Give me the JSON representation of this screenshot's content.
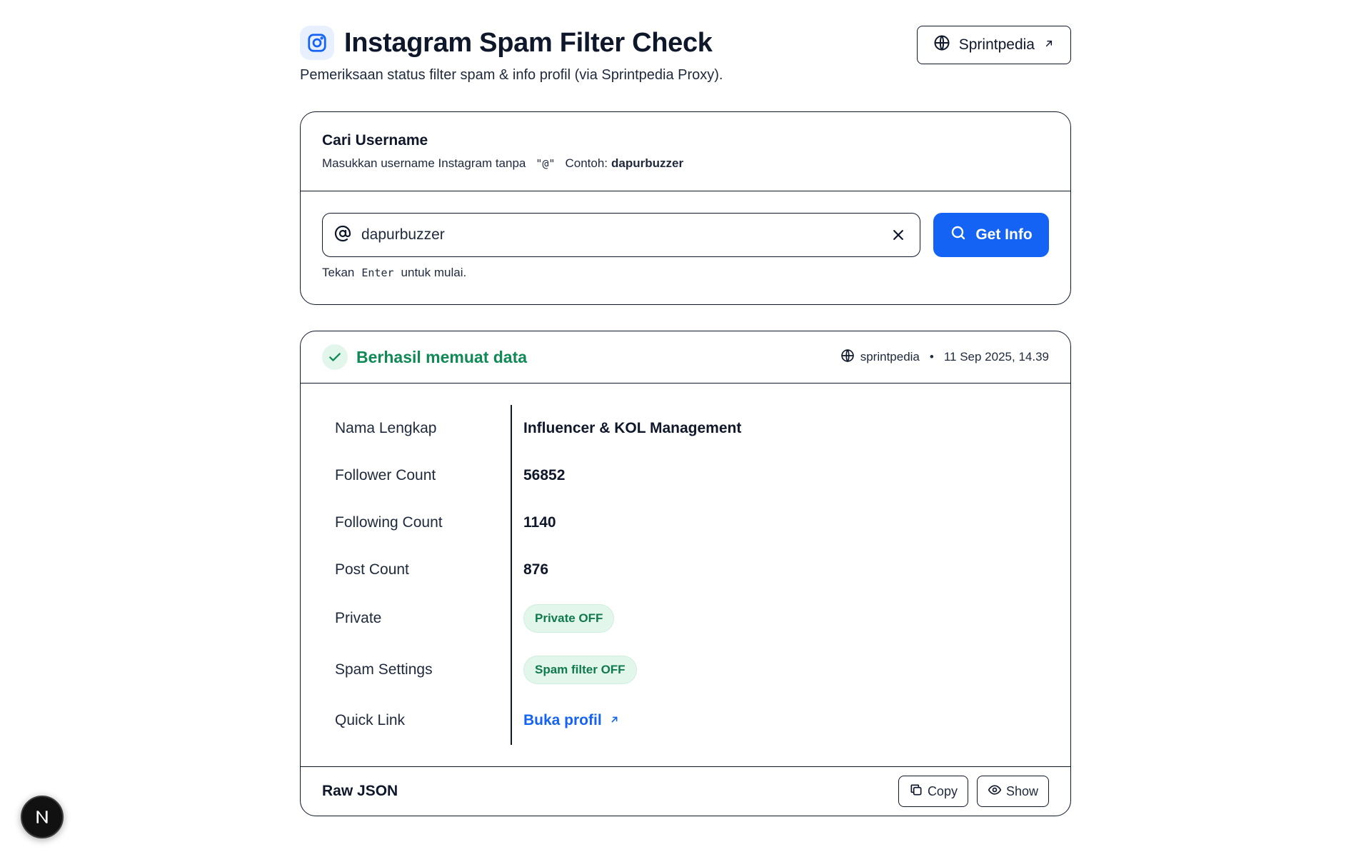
{
  "header": {
    "title": "Instagram Spam Filter Check",
    "subtitle": "Pemeriksaan status filter spam & info profil (via Sprintpedia Proxy).",
    "icon": "instagram-icon",
    "external_button": {
      "label": "Sprintpedia",
      "icon": "globe-icon",
      "trailing_icon": "arrow-up-right-icon"
    }
  },
  "search": {
    "title": "Cari Username",
    "desc_prefix": "Masukkan username Instagram tanpa",
    "desc_code": "\"@\"",
    "desc_example_label": "Contoh:",
    "desc_example_value": "dapurbuzzer",
    "input_value": "dapurbuzzer",
    "input_prefix_icon": "at-icon",
    "clear_icon": "close-icon",
    "button_label": "Get Info",
    "button_icon": "search-icon",
    "hint_prefix": "Tekan",
    "hint_key": "Enter",
    "hint_suffix": "untuk mulai."
  },
  "result": {
    "status_icon": "check-icon",
    "status_text": "Berhasil memuat data",
    "source": "sprintpedia",
    "source_icon": "globe-icon",
    "separator": "•",
    "timestamp": "11 Sep 2025, 14.39",
    "rows": [
      {
        "label": "Nama Lengkap",
        "value": "Influencer & KOL Management"
      },
      {
        "label": "Follower Count",
        "value": "56852"
      },
      {
        "label": "Following Count",
        "value": "1140"
      },
      {
        "label": "Post Count",
        "value": "876"
      },
      {
        "label": "Private",
        "value": "Private OFF"
      },
      {
        "label": "Spam Settings",
        "value": "Spam filter OFF"
      },
      {
        "label": "Quick Link",
        "value": "Buka profil"
      }
    ],
    "raw_json_label": "Raw JSON",
    "copy_label": "Copy",
    "copy_icon": "copy-icon",
    "show_label": "Show",
    "show_icon": "eye-icon"
  },
  "floating": {
    "letter": "N"
  },
  "colors": {
    "accent": "#1463f5",
    "success": "#0f8a55",
    "success_bg": "#e3f6ec",
    "border": "#0f172a",
    "text": "#0f172a"
  }
}
